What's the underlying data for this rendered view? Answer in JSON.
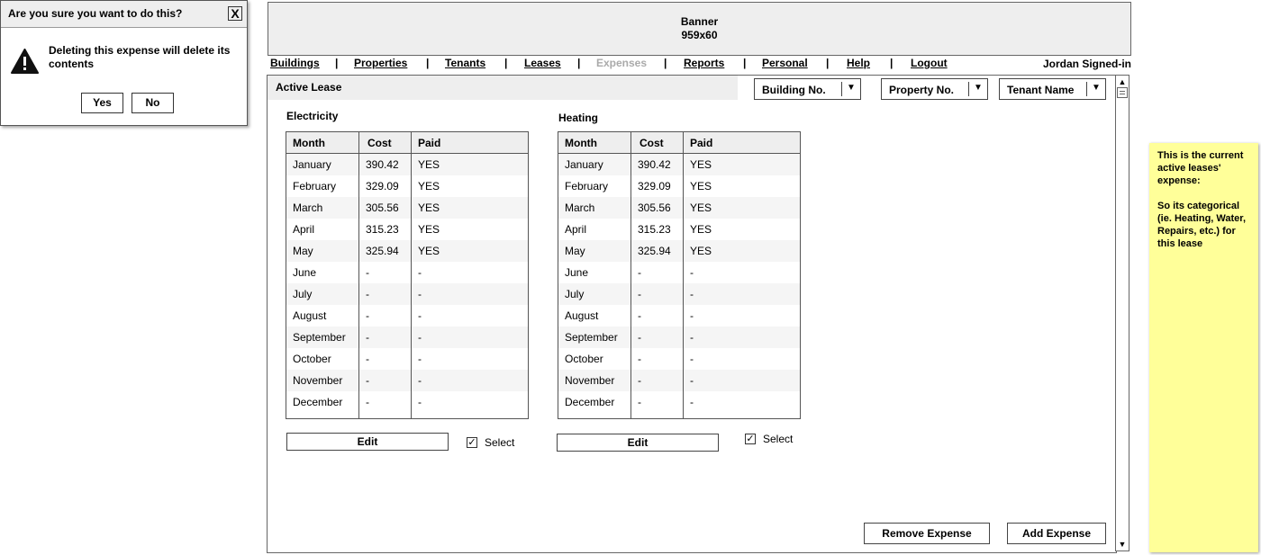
{
  "banner": {
    "line1": "Banner",
    "line2": "959x60"
  },
  "nav": {
    "items": [
      "Buildings",
      "Properties",
      "Tenants",
      "Leases",
      "Expenses",
      "Reports",
      "Personal",
      "Help",
      "Logout"
    ],
    "separator": "|",
    "active": "Expenses"
  },
  "user": {
    "signed_in": "Jordan Signed-in"
  },
  "main": {
    "header": "Active Lease",
    "filters": {
      "building": "Building No.",
      "property": "Property No.",
      "tenant": "Tenant Name",
      "arrow": "▼"
    }
  },
  "columns": [
    "Month",
    "Cost",
    "Paid"
  ],
  "electricity": {
    "title": "Electricity",
    "rows": [
      [
        "January",
        "390.42",
        "YES"
      ],
      [
        "February",
        "329.09",
        "YES"
      ],
      [
        "March",
        "305.56",
        "YES"
      ],
      [
        "April",
        "315.23",
        "YES"
      ],
      [
        "May",
        "325.94",
        "YES"
      ],
      [
        "June",
        "-",
        "-"
      ],
      [
        "July",
        "-",
        "-"
      ],
      [
        "August",
        "-",
        "-"
      ],
      [
        "September",
        "-",
        "-"
      ],
      [
        "October",
        "-",
        "-"
      ],
      [
        "November",
        "-",
        "-"
      ],
      [
        "December",
        "-",
        "-"
      ]
    ],
    "edit_label": "Edit",
    "select_label": "Select",
    "selected": true
  },
  "heating": {
    "title": "Heating",
    "rows": [
      [
        "January",
        "390.42",
        "YES"
      ],
      [
        "February",
        "329.09",
        "YES"
      ],
      [
        "March",
        "305.56",
        "YES"
      ],
      [
        "April",
        "315.23",
        "YES"
      ],
      [
        "May",
        "325.94",
        "YES"
      ],
      [
        "June",
        "-",
        "-"
      ],
      [
        "July",
        "-",
        "-"
      ],
      [
        "August",
        "-",
        "-"
      ],
      [
        "September",
        "-",
        "-"
      ],
      [
        "October",
        "-",
        "-"
      ],
      [
        "November",
        "-",
        "-"
      ],
      [
        "December",
        "-",
        "-"
      ]
    ],
    "edit_label": "Edit",
    "select_label": "Select",
    "selected": true
  },
  "actions": {
    "remove": "Remove Expense",
    "add": "Add Expense"
  },
  "sticky_note": {
    "para1": "This is the current active leases' expense:",
    "para2": "So its categorical (ie. Heating, Water, Repairs, etc.) for this lease"
  },
  "dialog": {
    "title": "Are you sure you want to do this?",
    "message": "Deleting this expense will delete its contents",
    "yes": "Yes",
    "no": "No",
    "close": "X"
  },
  "icons": {
    "check": "✓",
    "scroll_up": "▲",
    "scroll_down": "▼"
  }
}
